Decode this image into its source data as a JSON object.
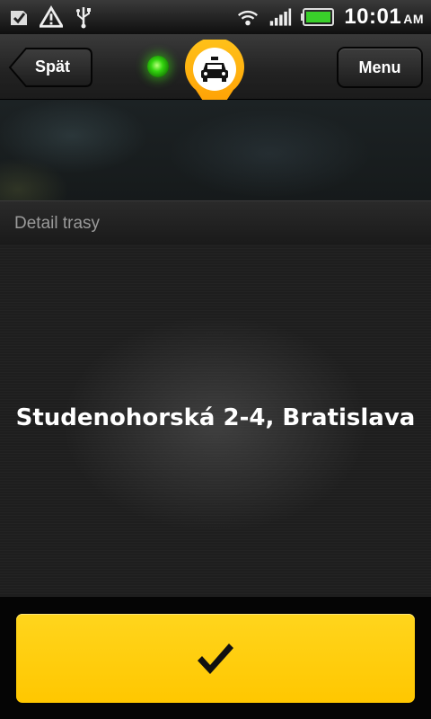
{
  "status_bar": {
    "icons_left": [
      "check-notification-icon",
      "warning-icon",
      "usb-icon"
    ],
    "icons_right": [
      "wifi-icon",
      "signal-icon",
      "battery-icon"
    ],
    "time": "10:01",
    "ampm": "AM"
  },
  "top_bar": {
    "back_label": "Spät",
    "menu_label": "Menu",
    "gps_status_color": "#33d60f",
    "pin_icon": "taxi-pin-icon",
    "accent_color": "#ffa500"
  },
  "section": {
    "title": "Detail trasy"
  },
  "main": {
    "address": "Studenohorská 2-4, Bratislava"
  },
  "confirm_button": {
    "icon": "checkmark-icon",
    "color": "#ffc700"
  }
}
